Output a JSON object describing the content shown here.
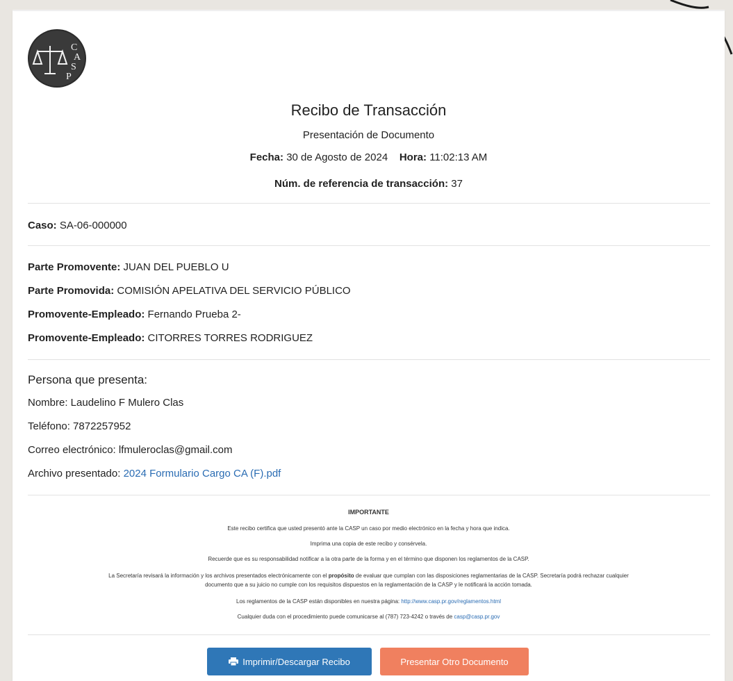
{
  "colors": {
    "primary_button": "#2f77b7",
    "secondary_button": "#f0805f",
    "link": "#2a6cb3"
  },
  "logo": {
    "icon": "scales-of-justice-logo",
    "letters": "CASP"
  },
  "receipt": {
    "title": "Recibo de Transacción",
    "subtitle": "Presentación de Documento",
    "fecha_label": "Fecha:",
    "fecha_value": "30 de Agosto de 2024",
    "hora_label": "Hora:",
    "hora_value": "11:02:13 AM",
    "ref_label": "Núm. de referencia de transacción:",
    "ref_value": "37"
  },
  "case": {
    "label": "Caso:",
    "value": "SA-06-000000"
  },
  "parties": [
    {
      "label": "Parte Promovente:",
      "value": "JUAN DEL PUEBLO U"
    },
    {
      "label": "Parte Promovida:",
      "value": "COMISIÓN APELATIVA DEL SERVICIO PÚBLICO"
    },
    {
      "label": "Promovente-Empleado:",
      "value": "Fernando Prueba 2-"
    },
    {
      "label": "Promovente-Empleado:",
      "value": "CITORRES TORRES RODRIGUEZ"
    }
  ],
  "presenter": {
    "title": "Persona que presenta:",
    "nombre": "Nombre: Laudelino F Mulero Clas",
    "telefono": "Teléfono: 7872257952",
    "correo": "Correo electrónico: lfmuleroclas@gmail.com",
    "archivo_label": "Archivo presentado:",
    "archivo_link": "2024 Formulario Cargo CA (F).pdf"
  },
  "important": {
    "title": "IMPORTANTE",
    "line1": "Este recibo certifica que usted presentó ante la CASP un caso por medio electrónico en la fecha y hora que indica.",
    "line2": "Imprima una copia de este recibo y consérvela.",
    "line3": "Recuerde que es su responsabilidad notificar a la otra parte de la forma y en el término que disponen los reglamentos de la CASP.",
    "line4_pre": "La Secretaría revisará la información y los archivos presentados electrónicamente con el",
    "line4_bold": "propósito",
    "line4_post": "de evaluar que cumplan con las disposiciones reglamentarias de la CASP. Secretaría podrá rechazar cualquier",
    "line4b": "documento que a su juicio no cumple con los requisitos dispuestos en la reglamentación de la CASP y le notificará la acción tomada.",
    "line5_pre": "Los reglamentos de la CASP están disponibles en nuestra página:",
    "line5_link": "http://www.casp.pr.gov/reglamentos.html",
    "line6_pre": "Cualquier duda con el procedimiento puede comunicarse al (787) 723-4242 o través de",
    "line6_link": "casp@casp.pr.gov"
  },
  "buttons": {
    "print": {
      "label": "Imprimir/Descargar Recibo",
      "icon": "print-icon"
    },
    "new_doc": {
      "label": "Presentar Otro Documento"
    }
  }
}
